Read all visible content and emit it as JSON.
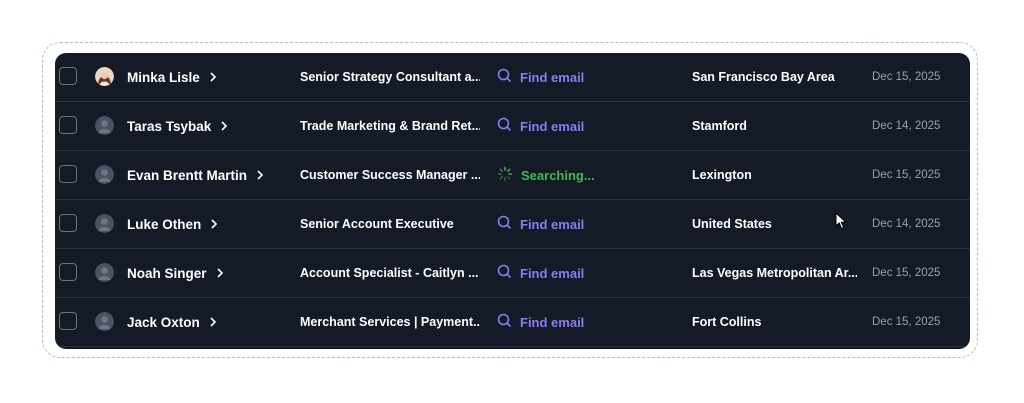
{
  "rows": [
    {
      "name": "Minka Lisle",
      "title": "Senior Strategy Consultant a...",
      "email": "Find email",
      "email_state": "find",
      "location": "San Francisco Bay Area",
      "date": "Dec 15, 2025",
      "avatar": "photo"
    },
    {
      "name": "Taras Tsybak",
      "title": "Trade Marketing & Brand Ret...",
      "email": "Find email",
      "email_state": "find",
      "location": "Stamford",
      "date": "Dec 14, 2025",
      "avatar": "default"
    },
    {
      "name": "Evan Brentt Martin",
      "title": "Customer Success Manager ...",
      "email": "Searching...",
      "email_state": "searching",
      "location": "Lexington",
      "date": "Dec 15, 2025",
      "avatar": "default"
    },
    {
      "name": "Luke Othen",
      "title": "Senior Account Executive",
      "email": "Find email",
      "email_state": "find",
      "location": "United States",
      "date": "Dec 14, 2025",
      "avatar": "default"
    },
    {
      "name": "Noah Singer",
      "title": "Account Specialist - Caitlyn ...",
      "email": "Find email",
      "email_state": "find",
      "location": "Las Vegas Metropolitan Ar...",
      "date": "Dec 15, 2025",
      "avatar": "default"
    },
    {
      "name": "Jack Oxton",
      "title": "Merchant Services | Payment...",
      "email": "Find email",
      "email_state": "find",
      "location": "Fort Collins",
      "date": "Dec 15, 2025",
      "avatar": "default"
    }
  ],
  "icons": {
    "find": "search-icon",
    "searching": "spinner-icon",
    "row_expand": "chevron-right-icon"
  },
  "colors": {
    "background": "#141a26",
    "find_email": "#8b7cf6",
    "searching": "#3fb950",
    "frame_dashed": "#b9b2f0"
  }
}
